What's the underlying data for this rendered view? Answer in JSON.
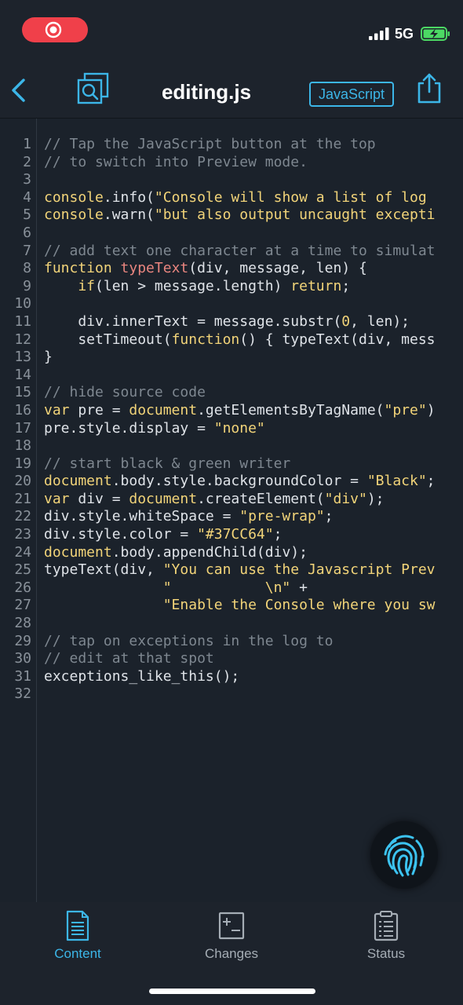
{
  "status_bar": {
    "network": "5G",
    "icons": [
      "screen-recording-icon",
      "signal-icon",
      "battery-charging-icon"
    ],
    "colors": {
      "recording": "#f0404a",
      "battery": "#4cd964"
    }
  },
  "nav": {
    "title": "editing.js",
    "language_button": "JavaScript",
    "icons": [
      "back-chevron-icon",
      "files-search-icon",
      "share-icon"
    ],
    "accent": "#3cb6e8"
  },
  "editor": {
    "lines": [
      {
        "n": "1",
        "tokens": [
          {
            "t": "// Tap the JavaScript button at the top",
            "c": "comment"
          }
        ]
      },
      {
        "n": "2",
        "tokens": [
          {
            "t": "// to switch into Preview mode.",
            "c": "comment"
          }
        ]
      },
      {
        "n": "3",
        "tokens": []
      },
      {
        "n": "4",
        "tokens": [
          {
            "t": "console",
            "c": "builtin"
          },
          {
            "t": ".info(",
            "c": "plain"
          },
          {
            "t": "\"Console will show a list of log",
            "c": "string"
          }
        ]
      },
      {
        "n": "5",
        "tokens": [
          {
            "t": "console",
            "c": "builtin"
          },
          {
            "t": ".warn(",
            "c": "plain"
          },
          {
            "t": "\"but also output uncaught excepti",
            "c": "string"
          }
        ]
      },
      {
        "n": "6",
        "tokens": []
      },
      {
        "n": "7",
        "tokens": [
          {
            "t": "// add text one character at a time to simulat",
            "c": "comment"
          }
        ]
      },
      {
        "n": "8",
        "tokens": [
          {
            "t": "function",
            "c": "keyword"
          },
          {
            "t": " ",
            "c": "plain"
          },
          {
            "t": "typeText",
            "c": "func"
          },
          {
            "t": "(div, message, len) {",
            "c": "plain"
          }
        ]
      },
      {
        "n": "9",
        "tokens": [
          {
            "t": "    if",
            "c": "keyword"
          },
          {
            "t": "(len > message.length) ",
            "c": "plain"
          },
          {
            "t": "return",
            "c": "keyword"
          },
          {
            "t": ";",
            "c": "plain"
          }
        ]
      },
      {
        "n": "10",
        "tokens": []
      },
      {
        "n": "11",
        "tokens": [
          {
            "t": "    div.innerText = message.substr(",
            "c": "plain"
          },
          {
            "t": "0",
            "c": "num"
          },
          {
            "t": ", len);",
            "c": "plain"
          }
        ]
      },
      {
        "n": "12",
        "tokens": [
          {
            "t": "    setTimeout(",
            "c": "plain"
          },
          {
            "t": "function",
            "c": "keyword"
          },
          {
            "t": "() { typeText(div, mess",
            "c": "plain"
          }
        ]
      },
      {
        "n": "13",
        "tokens": [
          {
            "t": "}",
            "c": "plain"
          }
        ]
      },
      {
        "n": "14",
        "tokens": []
      },
      {
        "n": "15",
        "tokens": [
          {
            "t": "// hide source code",
            "c": "comment"
          }
        ]
      },
      {
        "n": "16",
        "tokens": [
          {
            "t": "var",
            "c": "keyword"
          },
          {
            "t": " pre = ",
            "c": "plain"
          },
          {
            "t": "document",
            "c": "builtin"
          },
          {
            "t": ".getElementsByTagName(",
            "c": "plain"
          },
          {
            "t": "\"pre\"",
            "c": "string"
          },
          {
            "t": ")",
            "c": "plain"
          }
        ]
      },
      {
        "n": "17",
        "tokens": [
          {
            "t": "pre.style.display = ",
            "c": "plain"
          },
          {
            "t": "\"none\"",
            "c": "string"
          }
        ]
      },
      {
        "n": "18",
        "tokens": []
      },
      {
        "n": "19",
        "tokens": [
          {
            "t": "// start black & green writer",
            "c": "comment"
          }
        ]
      },
      {
        "n": "20",
        "tokens": [
          {
            "t": "document",
            "c": "builtin"
          },
          {
            "t": ".body.style.backgroundColor = ",
            "c": "plain"
          },
          {
            "t": "\"Black\"",
            "c": "string"
          },
          {
            "t": ";",
            "c": "plain"
          }
        ]
      },
      {
        "n": "21",
        "tokens": [
          {
            "t": "var",
            "c": "keyword"
          },
          {
            "t": " div = ",
            "c": "plain"
          },
          {
            "t": "document",
            "c": "builtin"
          },
          {
            "t": ".createElement(",
            "c": "plain"
          },
          {
            "t": "\"div\"",
            "c": "string"
          },
          {
            "t": ");",
            "c": "plain"
          }
        ]
      },
      {
        "n": "22",
        "tokens": [
          {
            "t": "div.style.whiteSpace = ",
            "c": "plain"
          },
          {
            "t": "\"pre-wrap\"",
            "c": "string"
          },
          {
            "t": ";",
            "c": "plain"
          }
        ]
      },
      {
        "n": "23",
        "tokens": [
          {
            "t": "div.style.color = ",
            "c": "plain"
          },
          {
            "t": "\"#37CC64\"",
            "c": "string"
          },
          {
            "t": ";",
            "c": "plain"
          }
        ]
      },
      {
        "n": "24",
        "tokens": [
          {
            "t": "document",
            "c": "builtin"
          },
          {
            "t": ".body.appendChild(div);",
            "c": "plain"
          }
        ]
      },
      {
        "n": "25",
        "tokens": [
          {
            "t": "typeText(div, ",
            "c": "plain"
          },
          {
            "t": "\"You can use the Javascript Prev",
            "c": "string"
          }
        ]
      },
      {
        "n": "26",
        "tokens": [
          {
            "t": "              ",
            "c": "plain"
          },
          {
            "t": "\"           \\n\"",
            "c": "string"
          },
          {
            "t": " +",
            "c": "plain"
          }
        ]
      },
      {
        "n": "27",
        "tokens": [
          {
            "t": "              ",
            "c": "plain"
          },
          {
            "t": "\"Enable the Console where you sw",
            "c": "string"
          }
        ]
      },
      {
        "n": "28",
        "tokens": []
      },
      {
        "n": "29",
        "tokens": [
          {
            "t": "// tap on exceptions in the log to",
            "c": "comment"
          }
        ]
      },
      {
        "n": "30",
        "tokens": [
          {
            "t": "// edit at that spot",
            "c": "comment"
          }
        ]
      },
      {
        "n": "31",
        "tokens": [
          {
            "t": "exceptions_like_this();",
            "c": "plain"
          }
        ]
      },
      {
        "n": "32",
        "tokens": []
      }
    ],
    "floating_icon": "fingerprint-icon"
  },
  "tabs": [
    {
      "label": "Content",
      "icon": "document-icon",
      "active": true
    },
    {
      "label": "Changes",
      "icon": "diff-icon",
      "active": false
    },
    {
      "label": "Status",
      "icon": "clipboard-list-icon",
      "active": false
    }
  ]
}
